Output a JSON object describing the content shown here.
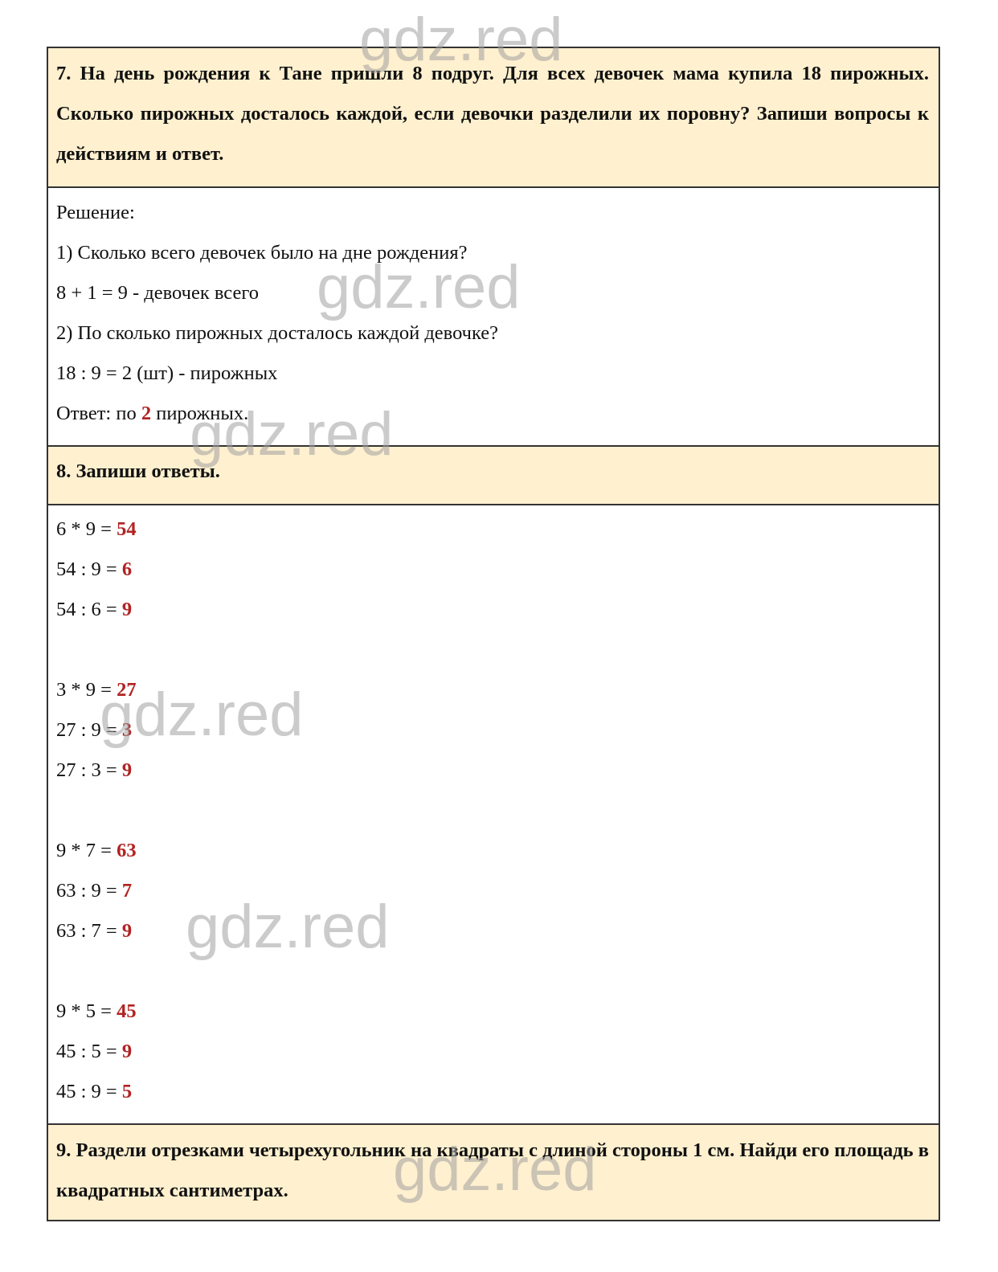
{
  "watermark": "gdz.red",
  "colors": {
    "task_bg": "#fff0cf",
    "answer": "#b22222",
    "border": "#333333"
  },
  "task7": {
    "text": "7. На день рождения к Тане пришли 8 подруг. Для всех девочек мама купила 18 пирожных. Сколько пирожных досталось каждой, если девочки разделили их поровну? Запиши вопросы к действиям и ответ."
  },
  "solution7": {
    "heading": "Решение:",
    "lines": [
      "1) Сколько всего девочек было на дне рождения?",
      "8 + 1 = 9 - девочек всего",
      "2) По сколько пирожных досталось каждой девочке?",
      "18 : 9 = 2 (шт) - пирожных"
    ],
    "answer_prefix": "Ответ: по ",
    "answer_value": "2",
    "answer_suffix": " пирожных."
  },
  "task8": {
    "text": "8. Запиши ответы."
  },
  "solution8": {
    "groups": [
      [
        {
          "expr": "6 * 9 = ",
          "ans": "54"
        },
        {
          "expr": "54 : 9 = ",
          "ans": "6"
        },
        {
          "expr": "54 : 6 = ",
          "ans": "9"
        }
      ],
      [
        {
          "expr": "3 * 9 = ",
          "ans": "27"
        },
        {
          "expr": "27 : 9 = ",
          "ans": "3"
        },
        {
          "expr": "27 : 3 = ",
          "ans": "9"
        }
      ],
      [
        {
          "expr": "9 * 7 = ",
          "ans": "63"
        },
        {
          "expr": "63 : 9 = ",
          "ans": "7"
        },
        {
          "expr": "63 : 7 = ",
          "ans": "9"
        }
      ],
      [
        {
          "expr": "9 * 5 = ",
          "ans": "45"
        },
        {
          "expr": "45 : 5 = ",
          "ans": "9"
        },
        {
          "expr": "45 : 9 = ",
          "ans": "5"
        }
      ]
    ]
  },
  "task9": {
    "text": "9. Раздели отрезками четырехугольник на квадраты с длиной стороны 1 см. Найди его площадь в квадратных сантиметрах."
  }
}
